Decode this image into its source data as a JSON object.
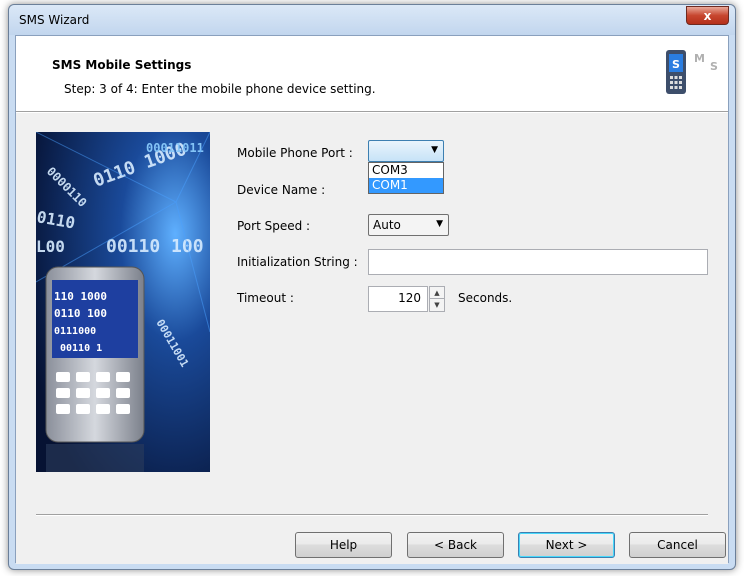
{
  "window": {
    "title": "SMS Wizard",
    "close_label": "x"
  },
  "header": {
    "title": "SMS Mobile Settings",
    "subtitle": "Step: 3 of 4: Enter the mobile phone device setting."
  },
  "form": {
    "port_label": "Mobile Phone Port :",
    "port_value": "",
    "port_options": [
      "COM3",
      "COM1"
    ],
    "port_selected_option": "COM1",
    "device_label": "Device Name :",
    "speed_label": "Port Speed :",
    "speed_value": "Auto",
    "init_label": "Initialization String :",
    "init_value": "",
    "timeout_label": "Timeout :",
    "timeout_value": "120",
    "timeout_unit": "Seconds."
  },
  "buttons": {
    "help": "Help",
    "back": "< Back",
    "next": "Next >",
    "cancel": "Cancel"
  },
  "colors": {
    "selection": "#3399ff",
    "frame": "#c9dcf2",
    "image_bg": "#0a1a3a"
  }
}
